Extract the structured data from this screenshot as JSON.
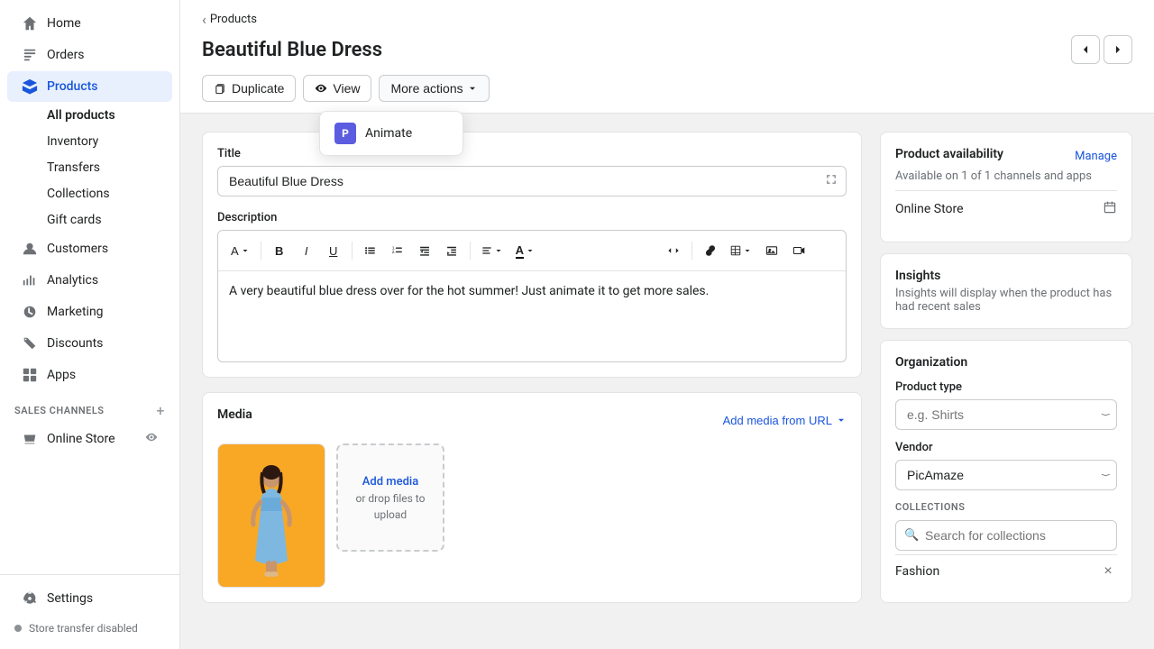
{
  "sidebar": {
    "items": [
      {
        "id": "home",
        "label": "Home",
        "icon": "home"
      },
      {
        "id": "orders",
        "label": "Orders",
        "icon": "orders"
      },
      {
        "id": "products",
        "label": "Products",
        "icon": "products",
        "active": true
      }
    ],
    "products_sub": [
      {
        "id": "all-products",
        "label": "All products",
        "active": true
      },
      {
        "id": "inventory",
        "label": "Inventory"
      },
      {
        "id": "transfers",
        "label": "Transfers"
      },
      {
        "id": "collections",
        "label": "Collections"
      },
      {
        "id": "gift-cards",
        "label": "Gift cards"
      }
    ],
    "other_items": [
      {
        "id": "customers",
        "label": "Customers",
        "icon": "customers"
      },
      {
        "id": "analytics",
        "label": "Analytics",
        "icon": "analytics"
      },
      {
        "id": "marketing",
        "label": "Marketing",
        "icon": "marketing"
      },
      {
        "id": "discounts",
        "label": "Discounts",
        "icon": "discounts"
      },
      {
        "id": "apps",
        "label": "Apps",
        "icon": "apps"
      }
    ],
    "sales_channels_header": "Sales channels",
    "sales_channels": [
      {
        "id": "online-store",
        "label": "Online Store"
      }
    ],
    "settings_label": "Settings",
    "store_status": "Store transfer disabled"
  },
  "breadcrumb": {
    "parent": "Products",
    "separator": "‹"
  },
  "page": {
    "title": "Beautiful Blue Dress",
    "toolbar": {
      "duplicate_label": "Duplicate",
      "view_label": "View",
      "more_actions_label": "More actions",
      "dropdown_item_label": "Animate",
      "dropdown_item_icon_text": "P"
    }
  },
  "product_form": {
    "title_label": "Title",
    "title_value": "Beautiful Blue Dress",
    "description_label": "Description",
    "description_content": "A very beautiful blue dress over for the hot summer! Just animate it to get more sales."
  },
  "media": {
    "section_label": "Media",
    "add_media_label": "Add media from URL",
    "add_media_placeholder": "Add media",
    "drop_text": "or drop files to",
    "upload_text": "upload"
  },
  "right_panel": {
    "availability": {
      "title": "Product availability",
      "manage_label": "Manage",
      "subtitle": "Available on 1 of 1 channels and apps",
      "channel_label": "Online Store"
    },
    "insights": {
      "title": "Insights",
      "body": "Insights will display when the product has had recent sales"
    },
    "organization": {
      "title": "Organization",
      "product_type_label": "Product type",
      "product_type_placeholder": "e.g. Shirts",
      "vendor_label": "Vendor",
      "vendor_value": "PicAmaze"
    },
    "collections": {
      "section_label": "COLLECTIONS",
      "search_placeholder": "Search for collections",
      "items": [
        {
          "label": "Fashion"
        }
      ]
    }
  }
}
